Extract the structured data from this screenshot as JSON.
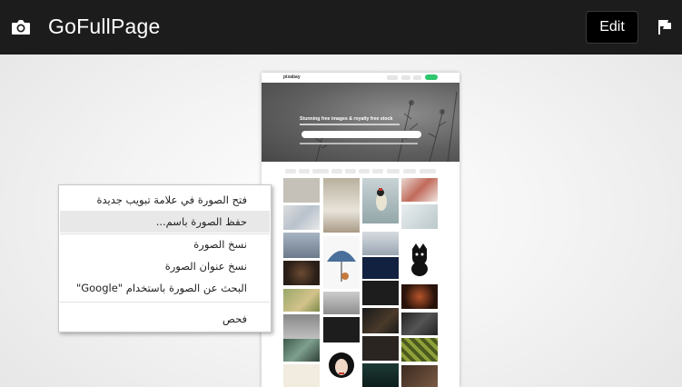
{
  "header": {
    "app_title": "GoFullPage",
    "edit_label": "Edit",
    "icons": [
      "camera-icon",
      "flag-icon"
    ]
  },
  "preview": {
    "logo": "pixabay",
    "hero_title": "Stunning free images & royalty free stock"
  },
  "context_menu": {
    "items": [
      "فتح الصورة في علامة تبويب جديدة",
      "حفظ الصورة باسم...",
      "نسخ الصورة",
      "نسخ عنوان الصورة",
      "البحث عن الصورة باستخدام \"Google\"",
      "فحص"
    ],
    "highlighted_index": 1
  }
}
